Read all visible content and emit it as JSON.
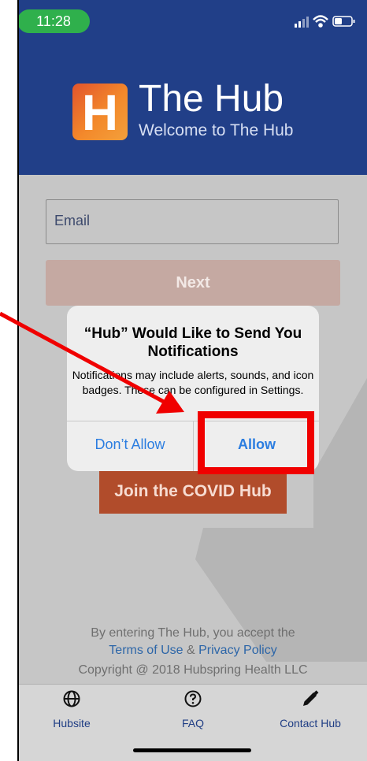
{
  "status_bar": {
    "time": "11:28"
  },
  "header": {
    "logo_letter": "H",
    "title": "The Hub",
    "subtitle": "Welcome to The Hub"
  },
  "login": {
    "email_placeholder": "Email",
    "next_label": "Next",
    "join_label": "Join the COVID Hub"
  },
  "footer": {
    "accept_text": "By entering The Hub, you accept the",
    "terms_link": "Terms of Use",
    "ampersand": "&",
    "privacy_link": "Privacy Policy",
    "copyright": "Copyright @ 2018 Hubspring Health LLC"
  },
  "tabbar": {
    "items": [
      {
        "label": "Hubsite",
        "icon": "globe-icon"
      },
      {
        "label": "FAQ",
        "icon": "question-circle-icon"
      },
      {
        "label": "Contact Hub",
        "icon": "pencil-icon"
      }
    ]
  },
  "alert": {
    "title": "“Hub” Would Like to Send You Notifications",
    "message": "Notifications may include alerts, sounds, and icon badges. These can be configured in Settings.",
    "deny_label": "Don’t Allow",
    "allow_label": "Allow"
  },
  "colors": {
    "header_bg": "#213f88",
    "next_button": "#c5a9a2",
    "join_button": "#b14c2b",
    "link": "#2d66a8",
    "annotation": "#f00000",
    "alert_button_text": "#2b7de0"
  }
}
